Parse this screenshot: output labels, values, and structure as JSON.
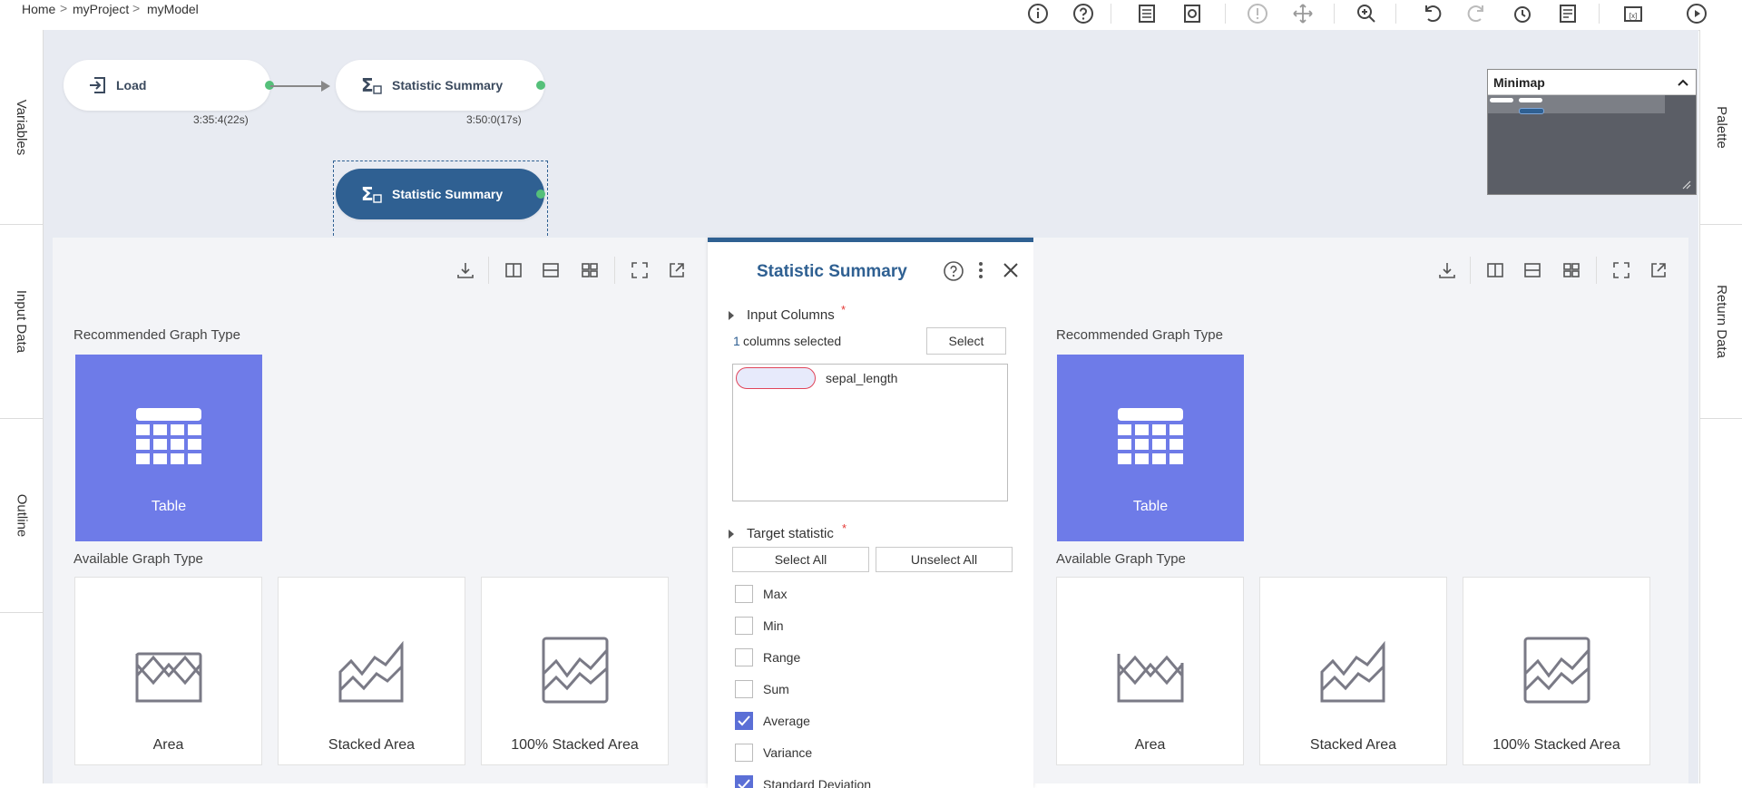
{
  "breadcrumb": [
    "Home",
    "myProject",
    "myModel"
  ],
  "left_rail": [
    "Variables",
    "Input Data",
    "Outline"
  ],
  "right_rail": [
    "Palette",
    "Return Data"
  ],
  "nodes": [
    {
      "label": "Load",
      "time": "3:35:4(22s)"
    },
    {
      "label": "Statistic Summary",
      "time": "3:50:0(17s)"
    },
    {
      "label": "Statistic Summary",
      "time": ""
    }
  ],
  "minimap": {
    "title": "Minimap"
  },
  "left_panel": {
    "recommended_title": "Recommended Graph Type",
    "recommended": "Table",
    "available_title": "Available Graph Type",
    "available": [
      "Area",
      "Stacked Area",
      "100% Stacked Area"
    ]
  },
  "right_panel": {
    "recommended_title": "Recommended Graph Type",
    "recommended": "Table",
    "available_title": "Available Graph Type",
    "available": [
      "Area",
      "Stacked Area",
      "100% Stacked Area"
    ]
  },
  "dialog": {
    "title": "Statistic Summary",
    "input_columns": {
      "label": "Input Columns",
      "required": "*",
      "count": "1",
      "count_text": "columns selected",
      "select_button": "Select",
      "columns": [
        "sepal_length"
      ]
    },
    "target_statistic": {
      "label": "Target statistic",
      "required": "*",
      "select_all": "Select All",
      "unselect_all": "Unselect All",
      "options": [
        {
          "label": "Max",
          "checked": false
        },
        {
          "label": "Min",
          "checked": false
        },
        {
          "label": "Range",
          "checked": false
        },
        {
          "label": "Sum",
          "checked": false
        },
        {
          "label": "Average",
          "checked": true
        },
        {
          "label": "Variance",
          "checked": false
        },
        {
          "label": "Standard Deviation",
          "checked": true
        }
      ]
    }
  },
  "colors": {
    "accent": "#2f6092",
    "tile": "#6e7be8",
    "port": "#55c07a",
    "canvas": "#e8ebf2"
  }
}
